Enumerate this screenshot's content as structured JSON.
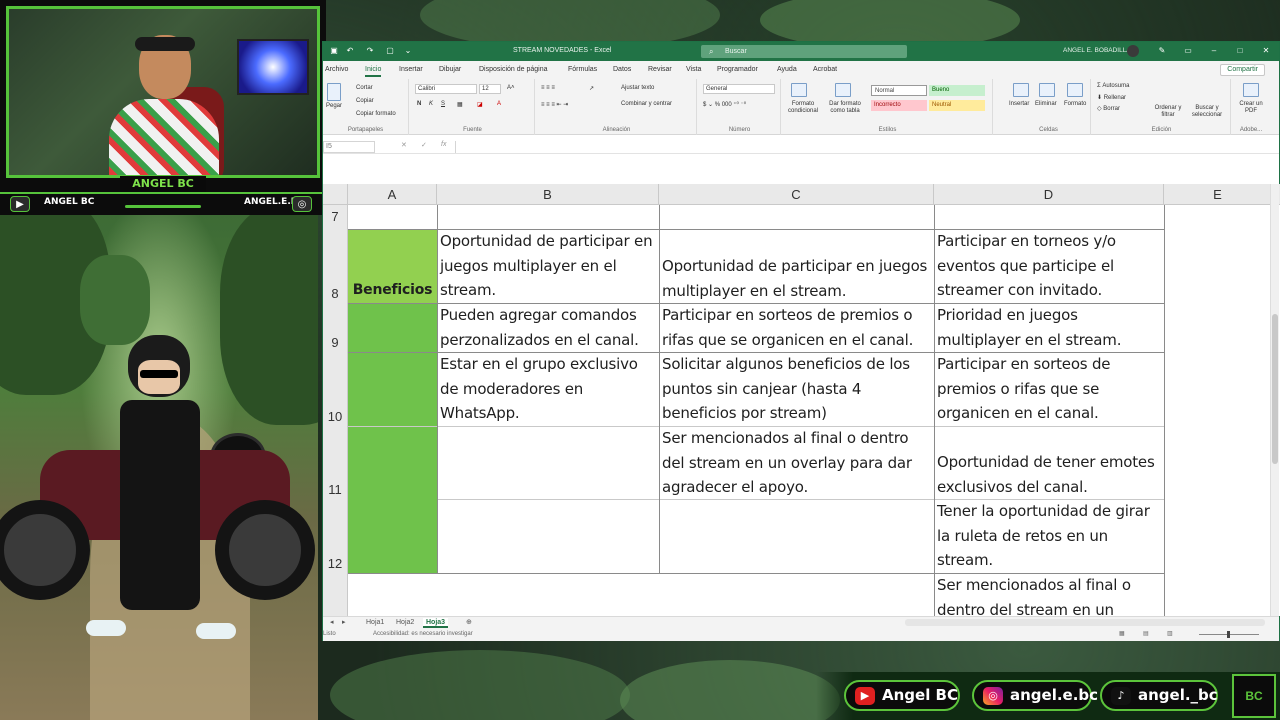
{
  "webcam": {
    "streamer_name": "ANGEL BC",
    "youtube_handle": "ANGEL BC",
    "instagram_handle": "ANGEL.E.BC"
  },
  "excel": {
    "window_title": "STREAM NOVEDADES - Excel",
    "search_placeholder": "Buscar",
    "user_name": "ANGEL E. BOBADILLA",
    "ribbon_tabs": [
      "Archivo",
      "Inicio",
      "Insertar",
      "Dibujar",
      "Disposición de página",
      "Fórmulas",
      "Datos",
      "Revisar",
      "Vista",
      "Programador",
      "Ayuda",
      "Acrobat"
    ],
    "active_tab": "Inicio",
    "share_label": "Compartir",
    "ribbon": {
      "clipboard": {
        "label": "Portapapeles",
        "paste": "Pegar",
        "cut": "Cortar",
        "copy": "Copiar",
        "format_painter": "Copiar formato"
      },
      "font": {
        "label": "Fuente",
        "font_name": "Calibri",
        "font_size": "12"
      },
      "alignment": {
        "label": "Alineación",
        "wrap": "Ajustar texto",
        "merge": "Combinar y centrar"
      },
      "number": {
        "label": "Número",
        "format": "General"
      },
      "styles": {
        "label": "Estilos",
        "conditional": "Formato condicional",
        "as_table": "Dar formato como tabla",
        "normal": "Normal",
        "bueno": "Bueno",
        "incorrecto": "Incorrecto",
        "neutral": "Neutral"
      },
      "cells": {
        "label": "Celdas",
        "insert": "Insertar",
        "delete": "Eliminar",
        "format": "Formato"
      },
      "editing": {
        "label": "Edición",
        "autosum": "Autosuma",
        "fill": "Rellenar",
        "clear": "Borrar",
        "sort": "Ordenar y filtrar",
        "find": "Buscar y seleccionar"
      },
      "pdf": {
        "label": "Adobe...",
        "create": "Crear un PDF"
      }
    },
    "name_box": "I5",
    "columns": [
      "A",
      "B",
      "C",
      "D",
      "E"
    ],
    "rows": [
      {
        "num": "7"
      },
      {
        "num": "8",
        "A": "Beneficios",
        "B": [
          "Oportunidad de participar en",
          "juegos multiplayer en el",
          "stream."
        ],
        "C": [
          "Oportunidad de participar en juegos",
          "multiplayer en el stream."
        ],
        "D": [
          "Participar en torneos y/o",
          "eventos que participe el",
          "streamer con invitado."
        ]
      },
      {
        "num": "9",
        "B": [
          "Pueden agregar comandos",
          "perzonalizados en el canal."
        ],
        "C": [
          "Participar en sorteos de premios o",
          "rifas que se organicen en el canal."
        ],
        "D": [
          "Prioridad en juegos",
          "multiplayer en el stream."
        ]
      },
      {
        "num": "10",
        "B": [
          "Estar en el grupo exclusivo",
          "de moderadores en",
          "WhatsApp."
        ],
        "C": [
          "Solicitar algunos beneficios de los",
          "puntos sin canjear (hasta 4",
          "beneficios por stream)"
        ],
        "D": [
          "Participar en sorteos de",
          "premios o rifas que se",
          "organicen en el canal."
        ]
      },
      {
        "num": "11",
        "C": [
          "Ser mencionados al final o dentro",
          "del stream en un overlay para dar",
          "agradecer el apoyo."
        ],
        "D": [
          "Oportunidad de tener emotes",
          "exclusivos del canal."
        ]
      },
      {
        "num": "12",
        "D": [
          "Tener la oportunidad de girar",
          "la ruleta de retos en un",
          "stream."
        ]
      },
      {
        "num": "",
        "D": [
          "Ser mencionados al final o",
          "dentro del stream en un"
        ]
      }
    ],
    "sheets": [
      "Hoja1",
      "Hoja2",
      "Hoja3"
    ],
    "active_sheet": "Hoja3",
    "status": {
      "ready": "Listo",
      "accessibility": "Accesibilidad: es necesario investigar"
    },
    "colors": {
      "accent": "#217346",
      "header_green": "#92d050",
      "cell_green": "#6fc24b"
    }
  },
  "socials": {
    "youtube": "Angel BC",
    "instagram": "angel.e.bc",
    "tiktok": "angel._bc",
    "logo": "BC"
  }
}
